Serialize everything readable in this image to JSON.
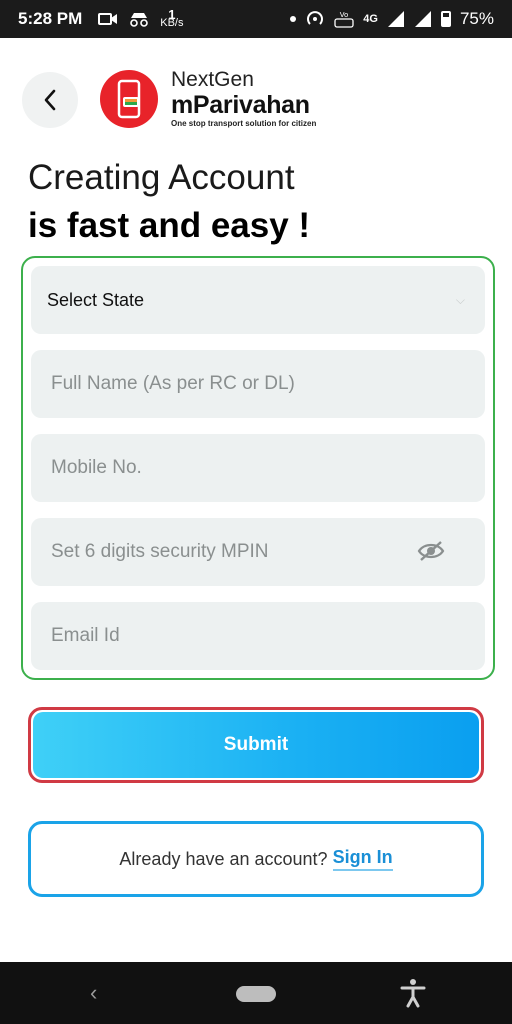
{
  "status_bar": {
    "time": "5:28 PM",
    "speed_value": "1",
    "speed_unit": "KB/s",
    "network": "4G",
    "battery": "75%"
  },
  "header": {
    "brand_top": "NextGen",
    "brand_main": "mParivahan",
    "tagline": "One stop transport solution for citizen"
  },
  "heading": {
    "line1": "Creating Account",
    "line2": "is fast and easy !"
  },
  "form": {
    "state_value": "Select State",
    "full_name_placeholder": "Full Name (As per RC or DL)",
    "mobile_placeholder": "Mobile No.",
    "mpin_placeholder": "Set 6 digits security MPIN",
    "email_placeholder": "Email Id"
  },
  "actions": {
    "submit_label": "Submit",
    "signin_prompt": "Already have an account?",
    "signin_link": "Sign In"
  },
  "colors": {
    "accent_blue": "#1ab0f3",
    "form_border": "#3cb04c",
    "submit_border": "#d03a44",
    "logo_red": "#e8232a"
  }
}
